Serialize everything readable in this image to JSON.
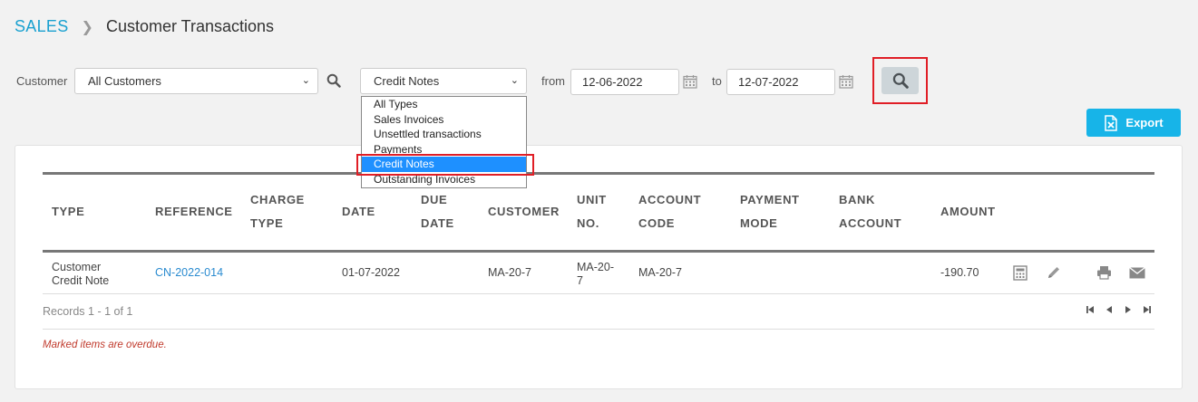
{
  "breadcrumb": {
    "section": "SALES",
    "page": "Customer Transactions"
  },
  "filters": {
    "customer_label": "Customer",
    "customer_value": "All Customers",
    "type_value": "Credit Notes",
    "type_options": [
      "All Types",
      "Sales Invoices",
      "Unsettled transactions",
      "Payments",
      "Credit Notes",
      "Outstanding Invoices"
    ],
    "from_label": "from",
    "from_value": "12-06-2022",
    "to_label": "to",
    "to_value": "12-07-2022"
  },
  "export_label": "Export",
  "table": {
    "headers": {
      "type": "TYPE",
      "reference": "REFERENCE",
      "charge1": "CHARGE",
      "charge2": "TYPE",
      "date": "DATE",
      "due1": "DUE",
      "due2": "DATE",
      "customer": "CUSTOMER",
      "unit1": "UNIT",
      "unit2": "NO.",
      "account1": "ACCOUNT",
      "account2": "CODE",
      "payment1": "PAYMENT",
      "payment2": "MODE",
      "bank1": "BANK",
      "bank2": "ACCOUNT",
      "amount": "AMOUNT"
    },
    "rows": [
      {
        "type1": "Customer",
        "type2": "Credit Note",
        "reference": "CN-2022-014",
        "date": "01-07-2022",
        "customer": "MA-20-7",
        "unit1": "MA-20-",
        "unit2": "7",
        "account_code": "MA-20-7",
        "amount": "-190.70"
      }
    ]
  },
  "records_text": "Records 1 - 1 of 1",
  "overdue_note": "Marked items are overdue.",
  "colors": {
    "accent": "#1aa1d0",
    "export": "#17b4e8",
    "highlight": "#e01e26",
    "selected": "#1e90ff"
  }
}
